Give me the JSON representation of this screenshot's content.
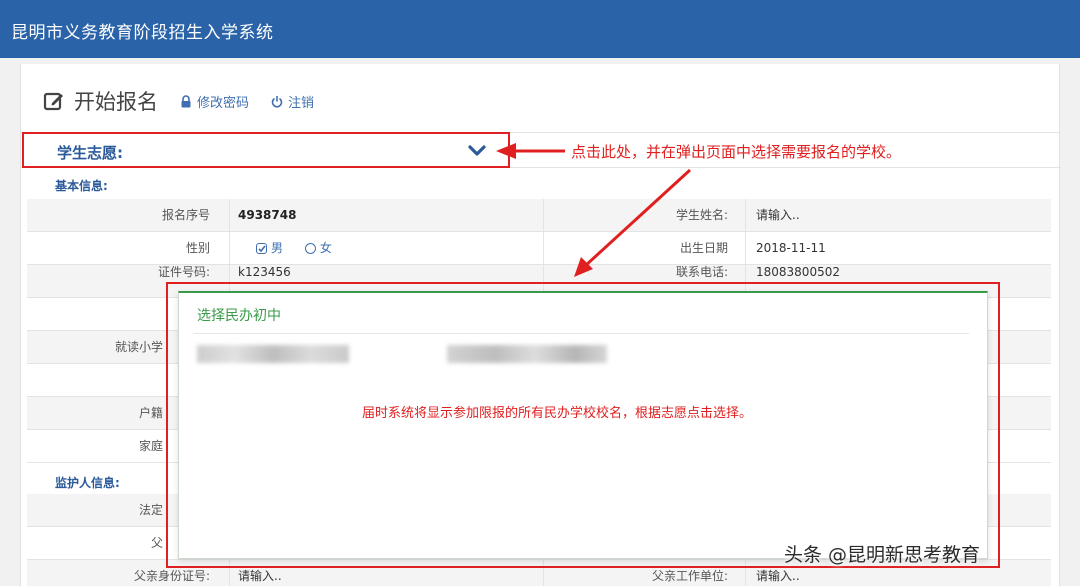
{
  "app": {
    "title": "昆明市义务教育阶段招生入学系统"
  },
  "header": {
    "page_title": "开始报名",
    "change_password": "修改密码",
    "logout": "注销"
  },
  "choice": {
    "label": "学生志愿:"
  },
  "sections": {
    "basic_info": "基本信息:",
    "guardian_info": "监护人信息:"
  },
  "form": {
    "registration_no_label": "报名序号",
    "registration_no": "4938748",
    "student_name_label": "学生姓名:",
    "student_name_placeholder": "请输入..",
    "gender_label": "性别",
    "gender_male": "男",
    "gender_female": "女",
    "birth_date_label": "出生日期",
    "birth_date": "2018-11-11",
    "id_number_label": "证件号码:",
    "id_number": "k123456",
    "phone_label": "联系电话:",
    "phone": "18083800502",
    "primary_school_label_partial": "就读小学",
    "household_label_partial": "户籍",
    "home_label_partial": "家庭",
    "legal_label_partial": "法定",
    "father_label_partial": "父",
    "father_id_label": "父亲身份证号:",
    "father_id_placeholder": "请输入..",
    "father_work_label": "父亲工作单位:",
    "father_work_placeholder": "请输入.."
  },
  "modal": {
    "title": "选择民办初中",
    "note": "届时系统将显示参加限报的所有民办学校校名，根据志愿点击选择。"
  },
  "annotation": "点击此处，并在弹出页面中选择需要报名的学校。",
  "watermark": "头条 @昆明新思考教育",
  "colors": {
    "brand_blue": "#2a63a8",
    "annotation_red": "#e02020",
    "modal_green": "#3a9a4a",
    "link_blue": "#3f6fb0"
  }
}
